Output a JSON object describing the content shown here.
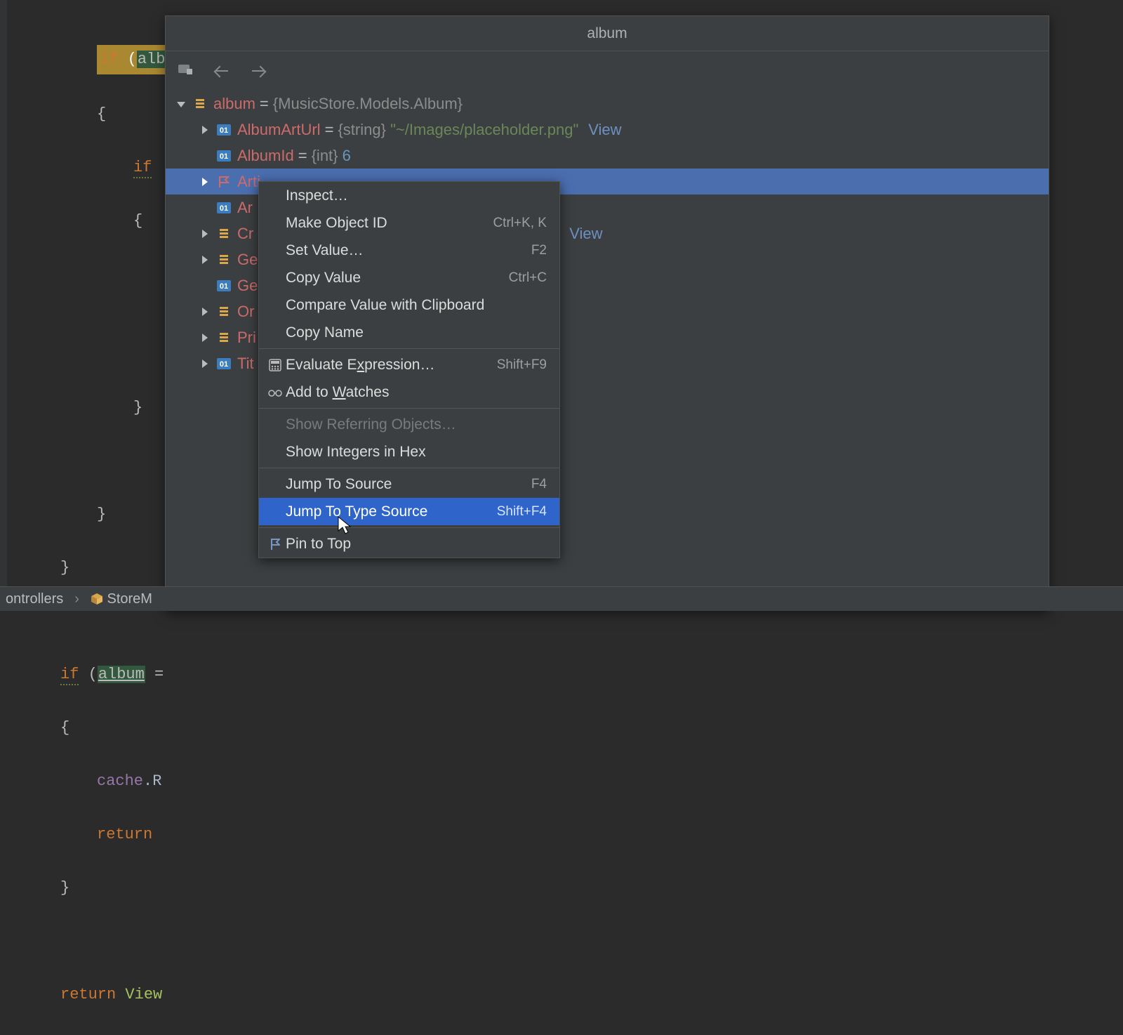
{
  "code": {
    "line_if_alb": "if (alb",
    "kw_if": "if",
    "paren": " (",
    "ident_alb": "alb",
    "brace_open": "{",
    "inner_if": "if",
    "brace_open2": "{",
    "brace_close2": "}",
    "brace_close1": "}",
    "brace_close0": "}",
    "kw_if2": "if",
    "ident_album": "album",
    "eq_end": " =",
    "brace_open3": "{",
    "cache": "cache",
    "dot_r": ".R",
    "kw_return": "return",
    "brace_close3": "}",
    "kw_return2": "return",
    "space": " ",
    "view": "View"
  },
  "popup": {
    "title": "album",
    "root": {
      "name": "album",
      "type": "{MusicStore.Models.Album}"
    },
    "nodes": {
      "albumArtUrl": {
        "name": "AlbumArtUrl",
        "type": "{string}",
        "value": "\"~/Images/placeholder.png\"",
        "link": "View"
      },
      "albumId": {
        "name": "AlbumId",
        "type": "{int}",
        "value": "6"
      },
      "artist": {
        "name": "Arti"
      },
      "artistId": {
        "name": "Ar"
      },
      "created": {
        "name": "Cr",
        "link": "View"
      },
      "genre": {
        "name": "Ge"
      },
      "genreId": {
        "name": "Ge"
      },
      "orderDetails": {
        "name": "Or"
      },
      "price": {
        "name": "Pri"
      },
      "title": {
        "name": "Tit"
      }
    }
  },
  "ctx": {
    "inspect": "Inspect…",
    "makeObjectId": "Make Object ID",
    "makeObjectId_short": "Ctrl+K, K",
    "setValue": "Set Value…",
    "setValue_short": "F2",
    "copyValue": "Copy Value",
    "copyValue_short": "Ctrl+C",
    "compare": "Compare Value with Clipboard",
    "copyName": "Copy Name",
    "evaluate_pre": "Evaluate E",
    "evaluate_u": "x",
    "evaluate_post": "pression…",
    "evaluate_short": "Shift+F9",
    "addWatches_pre": "Add to ",
    "addWatches_u": "W",
    "addWatches_post": "atches",
    "showReferring": "Show Referring Objects…",
    "showHex": "Show Integers in Hex",
    "jumpSource": "Jump To Source",
    "jumpSource_short": "F4",
    "jumpTypeSource": "Jump To Type Source",
    "jumpTypeSource_short": "Shift+F4",
    "pinTop": "Pin to Top"
  },
  "breadcrumb": {
    "seg1": "ontrollers",
    "seg2": "StoreM"
  }
}
